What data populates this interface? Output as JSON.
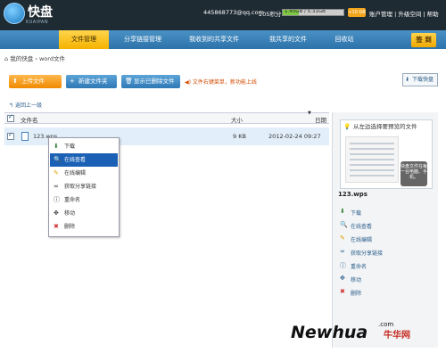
{
  "logo": {
    "text": "快盘",
    "sub": "KUAIPAN"
  },
  "account": {
    "email": "445868773@qq.com",
    "points": "205积分",
    "quota": "1.45GB / 5.31GB",
    "quota_used_fraction": 0.27,
    "quota_button": "+10 GB"
  },
  "top_links": "账户管理 | 升级空间 | 帮助",
  "nav": {
    "tabs": [
      "文件管理",
      "分享链接管理",
      "我收到的共享文件",
      "我共享的文件",
      "回收站"
    ],
    "active_index": 0,
    "signin": "签 到"
  },
  "breadcrumb": {
    "home": "我的快盘",
    "current": "word文件"
  },
  "toolbar": {
    "upload": "上传文件",
    "new_folder": "新建文件夹",
    "show_deleted": "显示已删除文件",
    "hint": "文件右键菜单，新功能上线",
    "client": "下载快盘"
  },
  "back_up": "返回上一级",
  "table": {
    "col_name": "文件名",
    "col_size": "大小",
    "col_date": "日期",
    "rows": [
      {
        "name": "123.wps",
        "size": "9 KB",
        "date": "2012-02-24 09:27"
      }
    ]
  },
  "context_menu": {
    "items": [
      "下载",
      "在线查看",
      "在线编辑",
      "获取分享链接",
      "重命名",
      "移动",
      "删除"
    ],
    "selected_index": 1
  },
  "preview": {
    "heading": "从左边选择要预览的文件",
    "note": "快盘文件在每一台电脑、手机。",
    "file_name": "123.wps",
    "actions": [
      "下载",
      "在线查看",
      "在线编辑",
      "获取分享链接",
      "重命名",
      "移动",
      "删除"
    ]
  },
  "watermark": {
    "main": "Newhua",
    "com": ".com",
    "cn": "牛华网"
  }
}
